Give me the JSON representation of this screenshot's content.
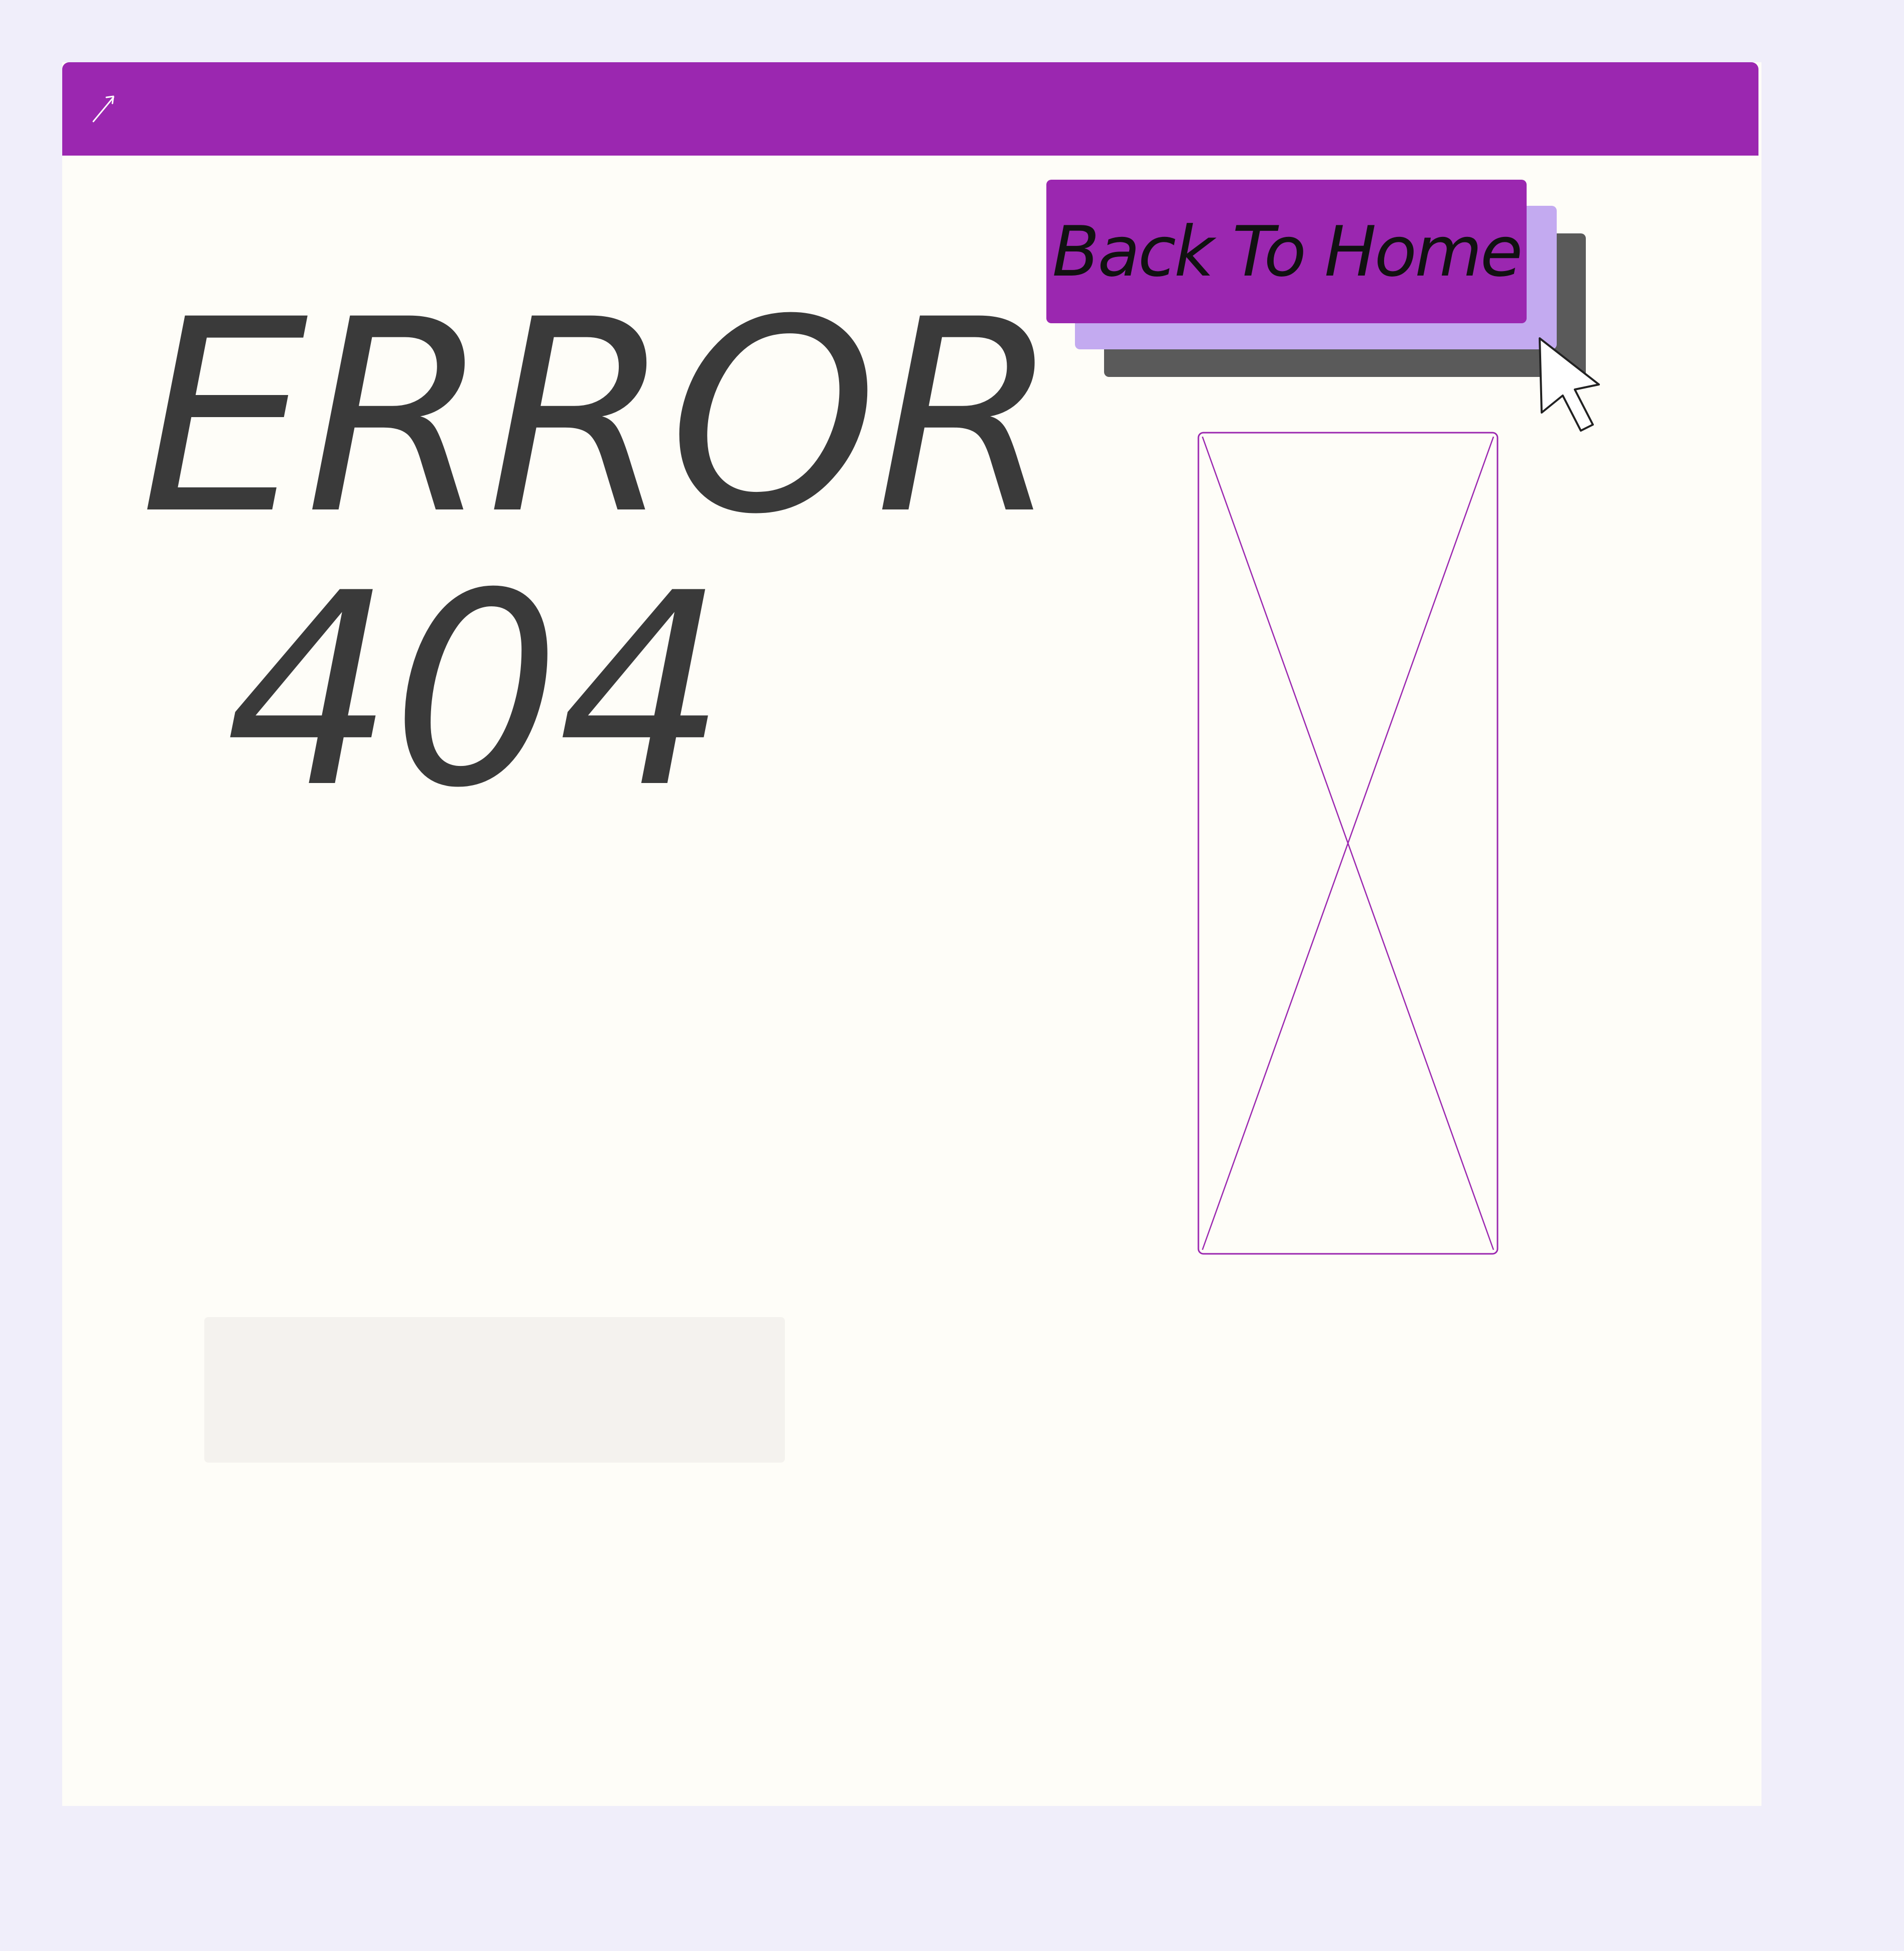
{
  "window": {
    "expand_icon": "expand-arrow-icon",
    "accent_color": "#9b27b0"
  },
  "main": {
    "headline_line1": "ERROR",
    "headline_line2": "404",
    "headline_color": "#3a3a3a"
  },
  "actions": {
    "home_button_label": "Back To Home",
    "cursor_icon": "pointer-cursor-icon"
  },
  "media": {
    "placeholder_icon": "image-placeholder-icon"
  },
  "colors": {
    "background": "#f0eefa",
    "canvas": "#fefdf8",
    "button_shadow_lilac": "#c3aaf0",
    "button_shadow_dark": "#5a5a5a",
    "panel_placeholder": "#f4f2ee"
  }
}
